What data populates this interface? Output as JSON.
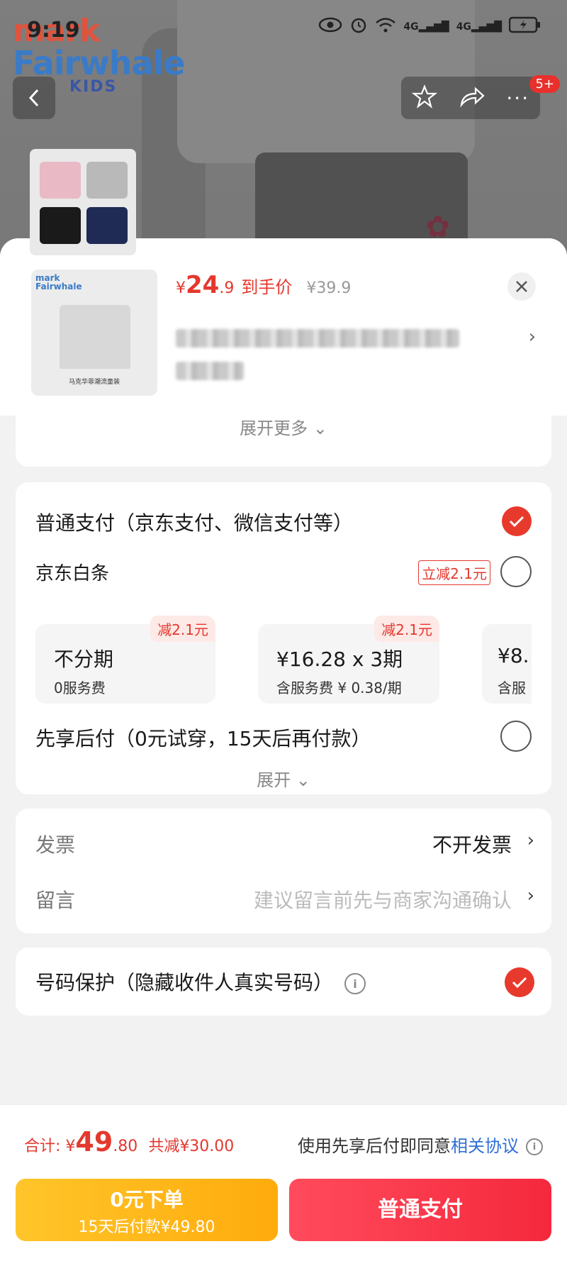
{
  "status": {
    "time": "9:19"
  },
  "brand": {
    "line1": "mark",
    "line2": "Fairwhale",
    "line3": "KIDS"
  },
  "nav": {
    "badge": "5+"
  },
  "product": {
    "price_symbol": "¥",
    "price_int": "24",
    "price_dec": ".9",
    "price_label": "到手价",
    "original_price": "¥39.9",
    "image_caption": "马克华菲潮流童装"
  },
  "expand_more": "展开更多",
  "payment": {
    "normal_pay_label": "普通支付（京东支付、微信支付等）",
    "baitiao_label": "京东白条",
    "baitiao_tag": "立减2.1元",
    "installments": [
      {
        "main": "不分期",
        "sub": "0服务费",
        "discount": "减2.1元"
      },
      {
        "main": "¥16.28 x 3期",
        "sub": "含服务费 ¥ 0.38/期",
        "discount": "减2.1元"
      },
      {
        "main": "¥8.",
        "sub": "含服"
      }
    ],
    "bnpl_label": "先享后付（0元试穿，15天后再付款）",
    "expand": "展开"
  },
  "invoice": {
    "invoice_label": "发票",
    "invoice_value": "不开发票",
    "message_label": "留言",
    "message_placeholder": "建议留言前先与商家沟通确认"
  },
  "privacy": {
    "label": "号码保护（隐藏收件人真实号码）"
  },
  "bottom": {
    "total_label": "合计:",
    "total_symbol": "¥",
    "total_int": "49",
    "total_dec": ".80",
    "total_cut": "共减¥30.00",
    "agree_text": "使用先享后付即同意",
    "agree_link": "相关协议",
    "btn_zero_main": "0元下单",
    "btn_zero_sub": "15天后付款¥49.80",
    "btn_normal": "普通支付"
  },
  "colors": {
    "accent": "#e4382e",
    "link": "#2f6fd6",
    "yellow": "#ffb619"
  }
}
